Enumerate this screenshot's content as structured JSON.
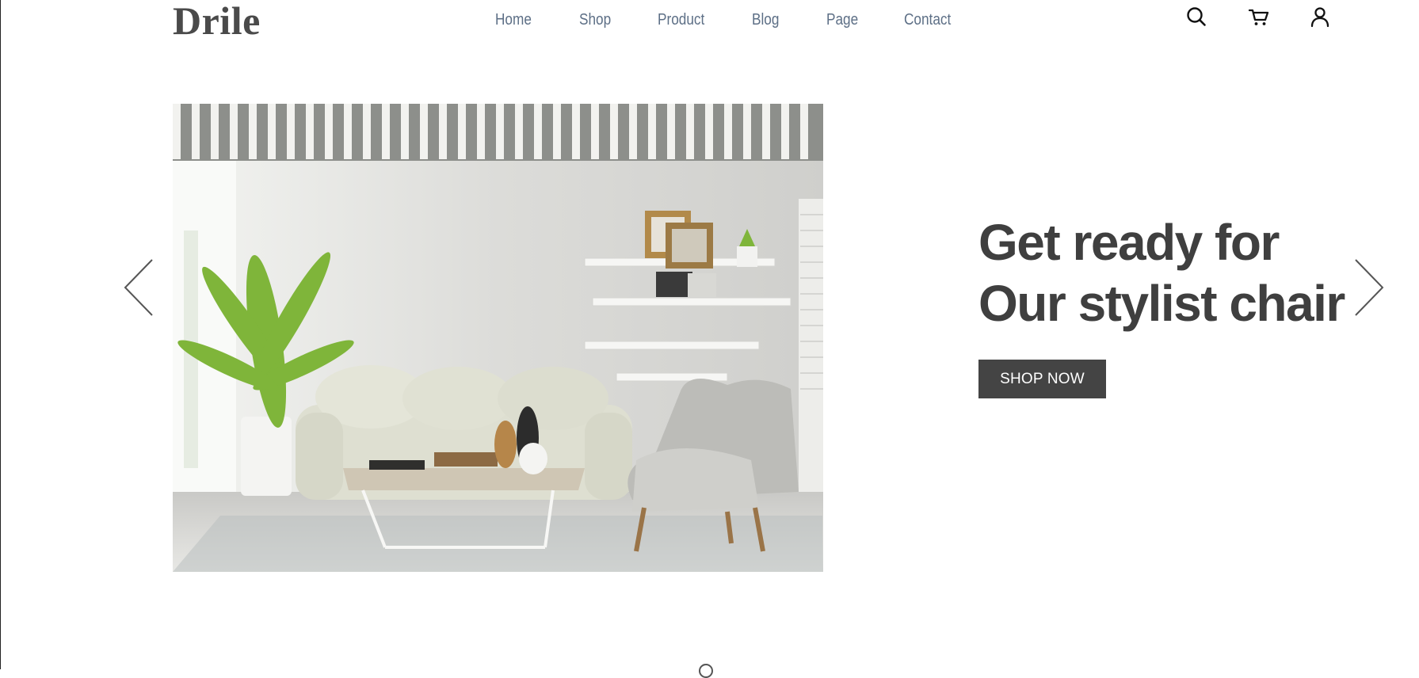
{
  "header": {
    "logo": "Drile",
    "nav": [
      {
        "label": "Home"
      },
      {
        "label": "Shop"
      },
      {
        "label": "Product"
      },
      {
        "label": "Blog"
      },
      {
        "label": "Page"
      },
      {
        "label": "Contact"
      }
    ],
    "icons": [
      "search-icon",
      "cart-icon",
      "user-icon"
    ]
  },
  "hero": {
    "image": "living-room-photo",
    "headline_line1": "Get ready for",
    "headline_line2": "Our stylist chair",
    "button_label": "SHOP NOW",
    "prev_icon": "chevron-left-icon",
    "next_icon": "chevron-right-icon"
  },
  "colors": {
    "logo": "#4a4a4a",
    "nav_text": "#5d6f86",
    "headline": "#3f3f3f",
    "button_bg": "#444444",
    "button_text": "#ffffff"
  }
}
